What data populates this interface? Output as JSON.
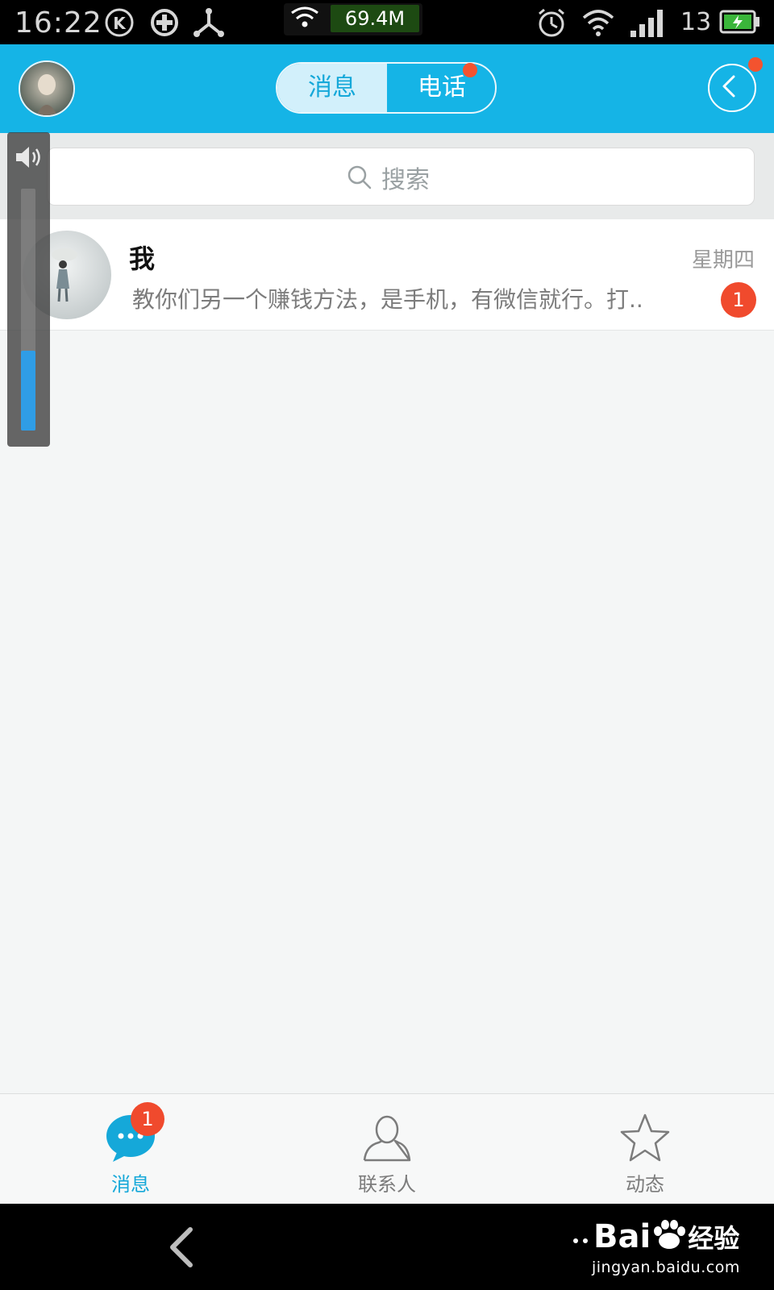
{
  "status_bar": {
    "time": "16:22",
    "net_speed": "69.4M",
    "battery_level": "13"
  },
  "header": {
    "tabs": [
      {
        "label": "消息",
        "active": true
      },
      {
        "label": "电话",
        "active": false,
        "has_dot": true
      }
    ]
  },
  "search": {
    "placeholder": "搜索"
  },
  "conversations": [
    {
      "name": "我",
      "time": "星期四",
      "preview": "教你们另一个赚钱方法，是手机，有微信就行。打..",
      "unread": "1"
    }
  ],
  "volume": {
    "level": 0.33
  },
  "bottom_tabs": [
    {
      "label": "消息",
      "icon": "chat-bubble-icon",
      "active": true,
      "badge": "1"
    },
    {
      "label": "联系人",
      "icon": "contacts-icon",
      "active": false
    },
    {
      "label": "动态",
      "icon": "star-icon",
      "active": false
    }
  ],
  "watermark": {
    "brand": "Bai",
    "brand_suffix": "经验",
    "url": "jingyan.baidu.com"
  },
  "colors": {
    "accent": "#15b4e6",
    "badge": "#f04a2d",
    "active_tab": "#15a8d9"
  }
}
